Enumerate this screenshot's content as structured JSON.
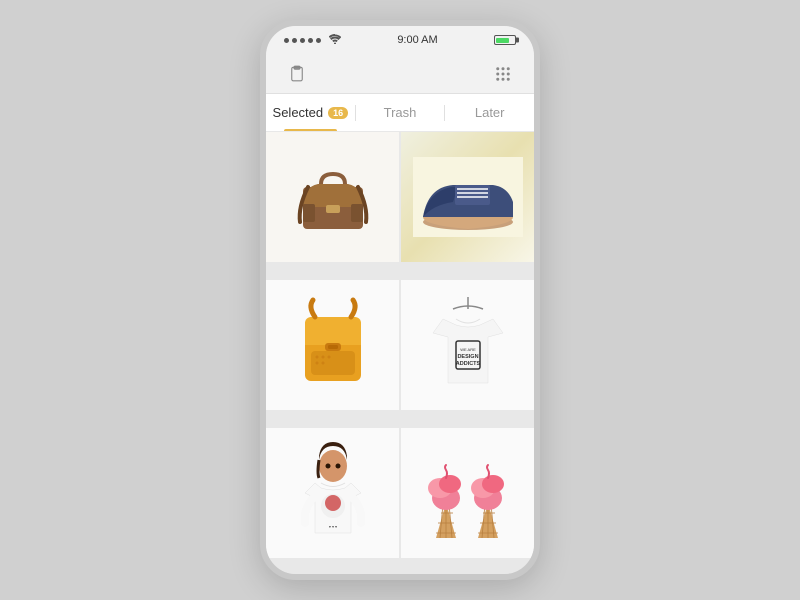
{
  "status_bar": {
    "time": "9:00 AM",
    "signal_dots": 5,
    "wifi": "wifi"
  },
  "tabs": [
    {
      "id": "selected",
      "label": "Selected",
      "badge": "16",
      "active": true
    },
    {
      "id": "trash",
      "label": "Trash",
      "badge": null,
      "active": false
    },
    {
      "id": "later",
      "label": "Later",
      "badge": null,
      "active": false
    }
  ],
  "products": [
    {
      "id": 1,
      "type": "bag",
      "alt": "Brown leather messenger bag"
    },
    {
      "id": 2,
      "type": "shoe",
      "alt": "Blue suede oxford shoe"
    },
    {
      "id": 3,
      "type": "backpack",
      "alt": "Yellow backpack"
    },
    {
      "id": 4,
      "type": "tshirt",
      "alt": "White design addicted t-shirt"
    },
    {
      "id": 5,
      "type": "girl-tshirt",
      "alt": "Woman in white t-shirt"
    },
    {
      "id": 6,
      "type": "icecream",
      "alt": "Pink ice cream cones"
    }
  ],
  "colors": {
    "accent": "#e8b84b",
    "active_tab_text": "#333333",
    "inactive_tab_text": "#999999",
    "background": "#d0d0d0",
    "phone_bg": "#f2f2f2"
  }
}
